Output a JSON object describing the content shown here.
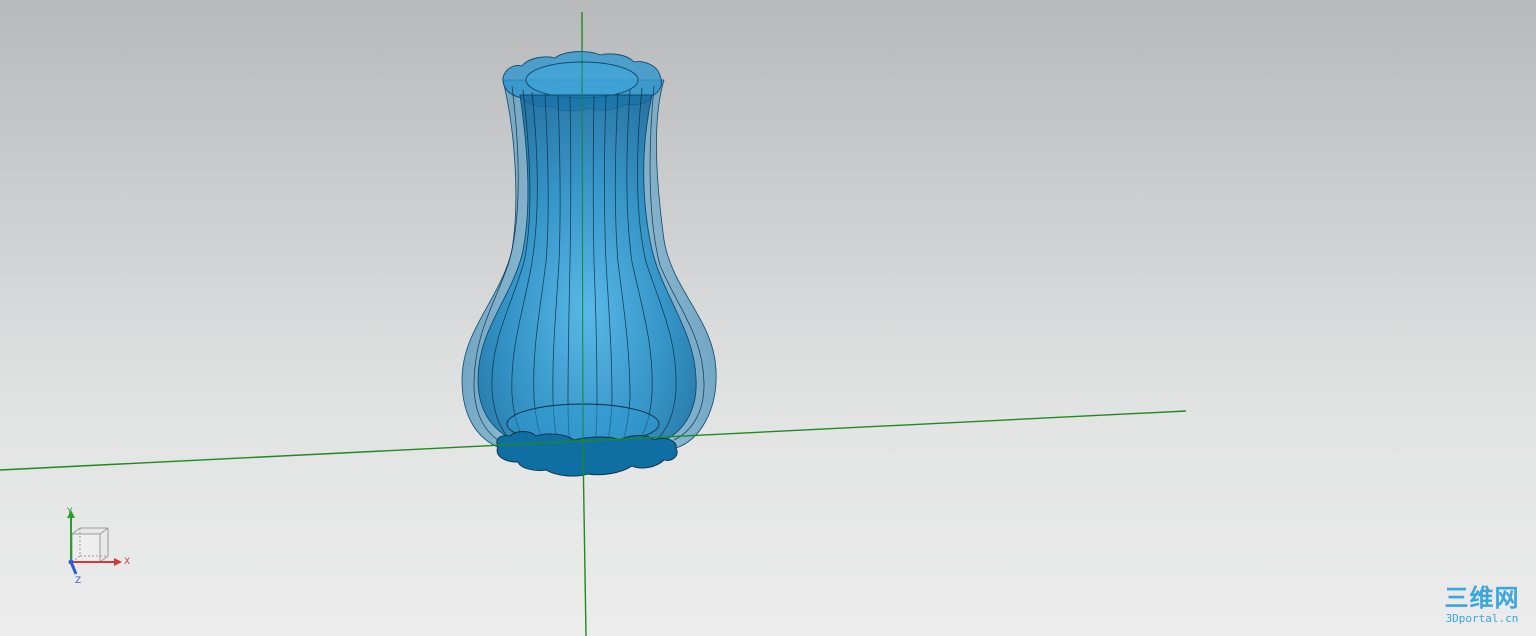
{
  "viewport": {
    "background_top": "#b8b9bb",
    "background_bottom": "#ececec"
  },
  "model": {
    "name": "vase-model",
    "body_color": "#1a86c0",
    "edge_color": "#0d2f44"
  },
  "axes": {
    "color": "#1f8a1f"
  },
  "triad": {
    "x_label": "X",
    "y_label": "Y",
    "z_label": "Z",
    "x_color": "#d23a3a",
    "y_color": "#28a028",
    "z_color": "#2f5fd0"
  },
  "watermark": {
    "title": "三维网",
    "subtitle": "3Dportal.cn",
    "color": "#3aa6dc"
  }
}
